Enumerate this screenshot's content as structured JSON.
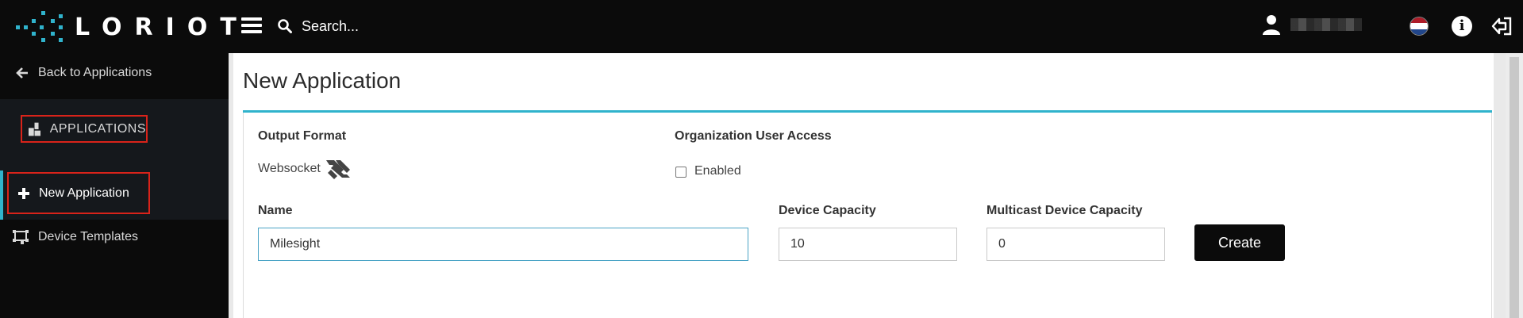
{
  "header": {
    "logo_text": "LORIOT",
    "search_placeholder": "Search...",
    "info_glyph": "i",
    "icons": [
      "menu-icon",
      "search-icon",
      "user-icon",
      "flag-netherlands-icon",
      "info-icon",
      "logout-icon"
    ],
    "flag_colors": [
      "#ae1c28",
      "#ffffff",
      "#21468b"
    ]
  },
  "sidebar": {
    "back_label": "Back to Applications",
    "section_label": "APPLICATIONS",
    "new_app_label": "New Application",
    "templates_label": "Device Templates"
  },
  "main": {
    "title": "New Application",
    "output_format": {
      "label": "Output Format",
      "value": "Websocket"
    },
    "org_access": {
      "label": "Organization User Access",
      "checkbox_label": "Enabled",
      "checked": false
    },
    "name": {
      "label": "Name",
      "value": "Milesight"
    },
    "device_capacity": {
      "label": "Device Capacity",
      "value": "10"
    },
    "multicast_capacity": {
      "label": "Multicast Device Capacity",
      "value": "0"
    },
    "create_label": "Create"
  },
  "colors": {
    "accent": "#30b3cc",
    "highlight": "#d9231a",
    "topbar": "#0b0b0b"
  }
}
